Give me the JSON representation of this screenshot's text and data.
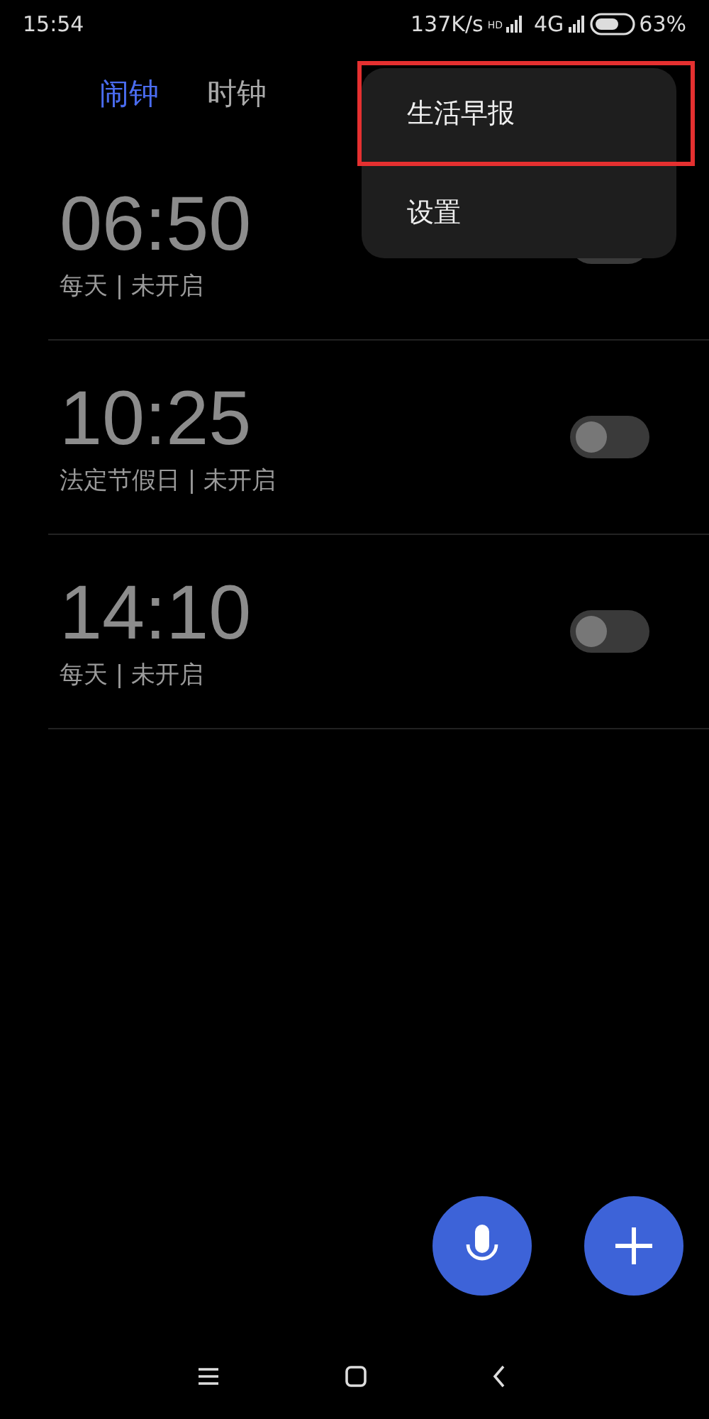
{
  "status_bar": {
    "time": "15:54",
    "speed": "137K/s",
    "hd": "HD",
    "network": "4G",
    "battery": "63%"
  },
  "tabs": [
    {
      "label": "闹钟",
      "selected": true
    },
    {
      "label": "时钟",
      "selected": false
    }
  ],
  "alarms": [
    {
      "time": "06:50",
      "details": "每天 | 未开启",
      "on": false
    },
    {
      "time": "10:25",
      "details": "法定节假日 | 未开启",
      "on": false
    },
    {
      "time": "14:10",
      "details": "每天 | 未开启",
      "on": false
    }
  ],
  "menu": [
    {
      "label": "生活早报",
      "highlighted": true
    },
    {
      "label": "设置",
      "highlighted": false
    }
  ]
}
